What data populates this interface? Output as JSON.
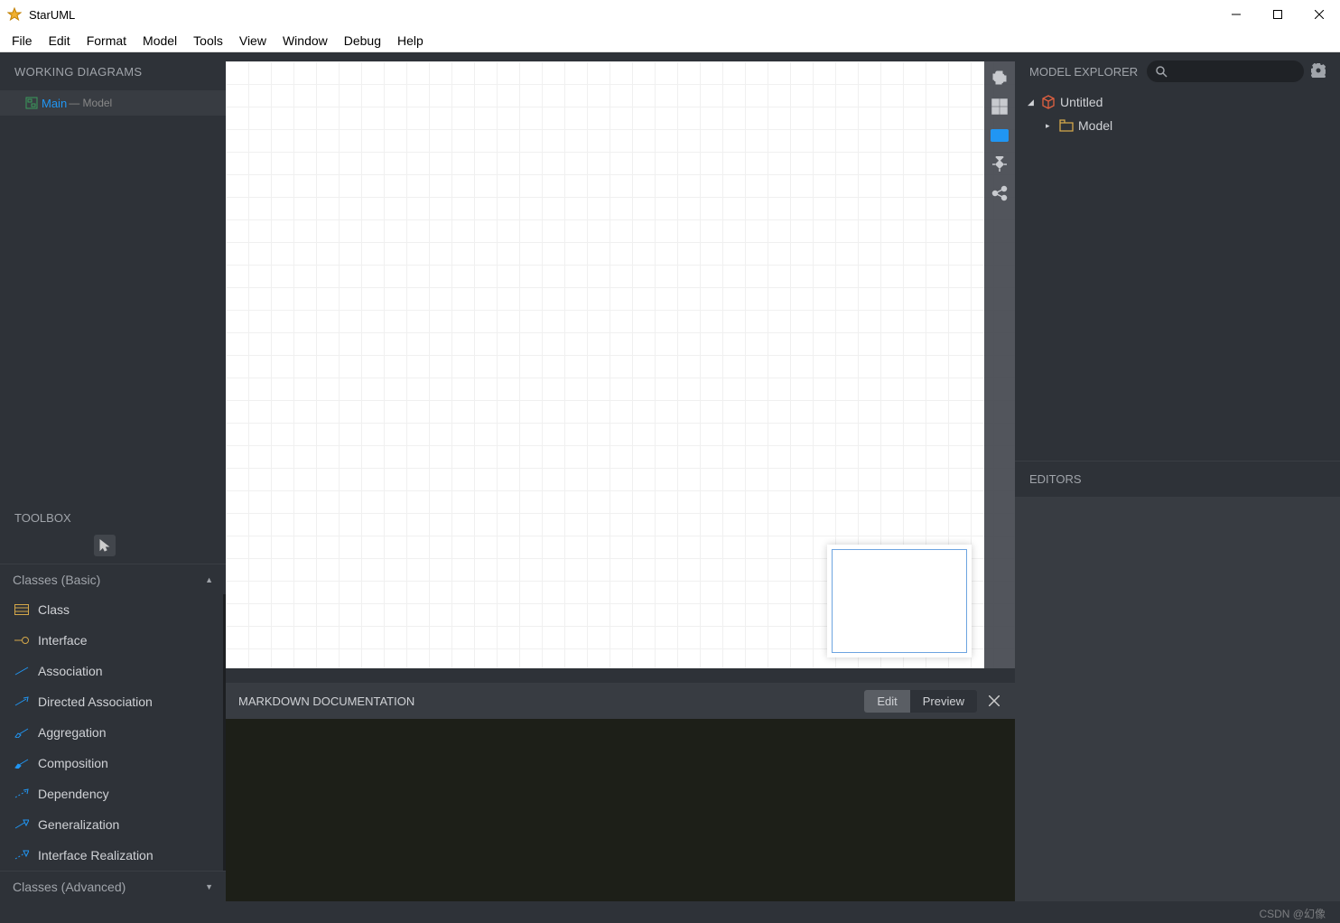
{
  "app": {
    "title": "StarUML"
  },
  "menu": [
    "File",
    "Edit",
    "Format",
    "Model",
    "Tools",
    "View",
    "Window",
    "Debug",
    "Help"
  ],
  "workingDiagrams": {
    "title": "WORKING DIAGRAMS",
    "items": [
      {
        "name": "Main",
        "sub": "— Model"
      }
    ]
  },
  "toolbox": {
    "title": "TOOLBOX",
    "groups": [
      {
        "title": "Classes (Basic)",
        "expanded": true,
        "items": [
          {
            "name": "Class",
            "icon": "class"
          },
          {
            "name": "Interface",
            "icon": "interface"
          },
          {
            "name": "Association",
            "icon": "association"
          },
          {
            "name": "Directed Association",
            "icon": "dassociation"
          },
          {
            "name": "Aggregation",
            "icon": "aggregation"
          },
          {
            "name": "Composition",
            "icon": "composition"
          },
          {
            "name": "Dependency",
            "icon": "dependency"
          },
          {
            "name": "Generalization",
            "icon": "generalization"
          },
          {
            "name": "Interface Realization",
            "icon": "realization"
          }
        ]
      },
      {
        "title": "Classes (Advanced)",
        "expanded": false
      }
    ]
  },
  "markdown": {
    "title": "MARKDOWN DOCUMENTATION",
    "tabs": {
      "edit": "Edit",
      "preview": "Preview"
    }
  },
  "modelExplorer": {
    "title": "MODEL EXPLORER",
    "tree": [
      {
        "exp": "▾",
        "icon": "cube",
        "label": "Untitled",
        "level": 0
      },
      {
        "exp": "▸",
        "icon": "package",
        "label": "Model",
        "level": 1
      }
    ]
  },
  "editors": {
    "title": "EDITORS"
  },
  "watermark": "CSDN @幻像"
}
